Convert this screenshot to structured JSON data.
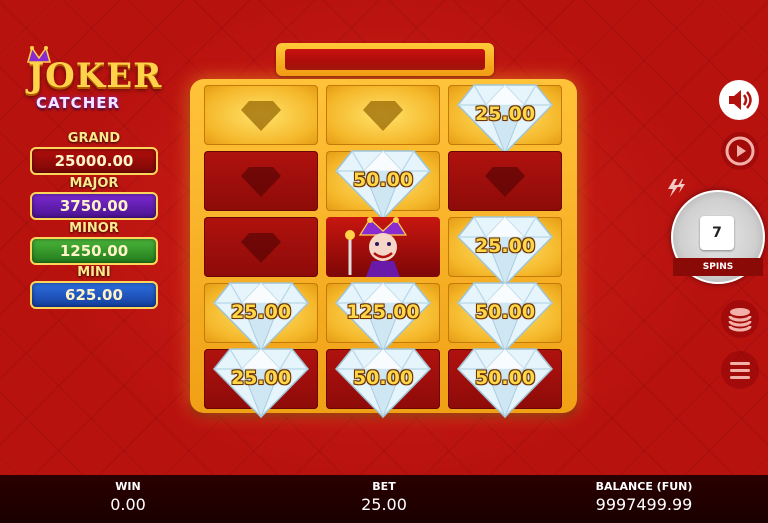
{
  "game": {
    "logo_line1": "JOKER",
    "logo_line2": "CATCHER"
  },
  "jackpots": [
    {
      "label": "GRAND",
      "value": "25000.00",
      "color": "#b20f0c"
    },
    {
      "label": "MAJOR",
      "value": "3750.00",
      "color": "#7b2ad1"
    },
    {
      "label": "MINOR",
      "value": "1250.00",
      "color": "#4ab53a"
    },
    {
      "label": "MINI",
      "value": "625.00",
      "color": "#2d6fe0"
    }
  ],
  "grid": [
    [
      {
        "type": "empty-gold"
      },
      {
        "type": "empty-gold"
      },
      {
        "type": "diamond",
        "value": "25.00"
      }
    ],
    [
      {
        "type": "empty-dark"
      },
      {
        "type": "diamond",
        "value": "50.00"
      },
      {
        "type": "empty-dark"
      }
    ],
    [
      {
        "type": "empty-dark"
      },
      {
        "type": "joker"
      },
      {
        "type": "diamond",
        "value": "25.00"
      }
    ],
    [
      {
        "type": "diamond",
        "value": "25.00"
      },
      {
        "type": "diamond",
        "value": "125.00"
      },
      {
        "type": "diamond",
        "value": "50.00"
      }
    ],
    [
      {
        "type": "diamond",
        "value": "25.00"
      },
      {
        "type": "diamond",
        "value": "50.00"
      },
      {
        "type": "diamond",
        "value": "50.00"
      }
    ]
  ],
  "controls": {
    "spins_count": "7",
    "spins_label": "SPINS",
    "icons": [
      "speaker-icon",
      "autoplay-icon",
      "turbo-icon",
      "coins-icon",
      "menu-icon"
    ]
  },
  "footer": {
    "win_label": "WIN",
    "win_value": "0.00",
    "bet_label": "BET",
    "bet_value": "25.00",
    "balance_label": "BALANCE (FUN)",
    "balance_value": "9997499.99"
  }
}
